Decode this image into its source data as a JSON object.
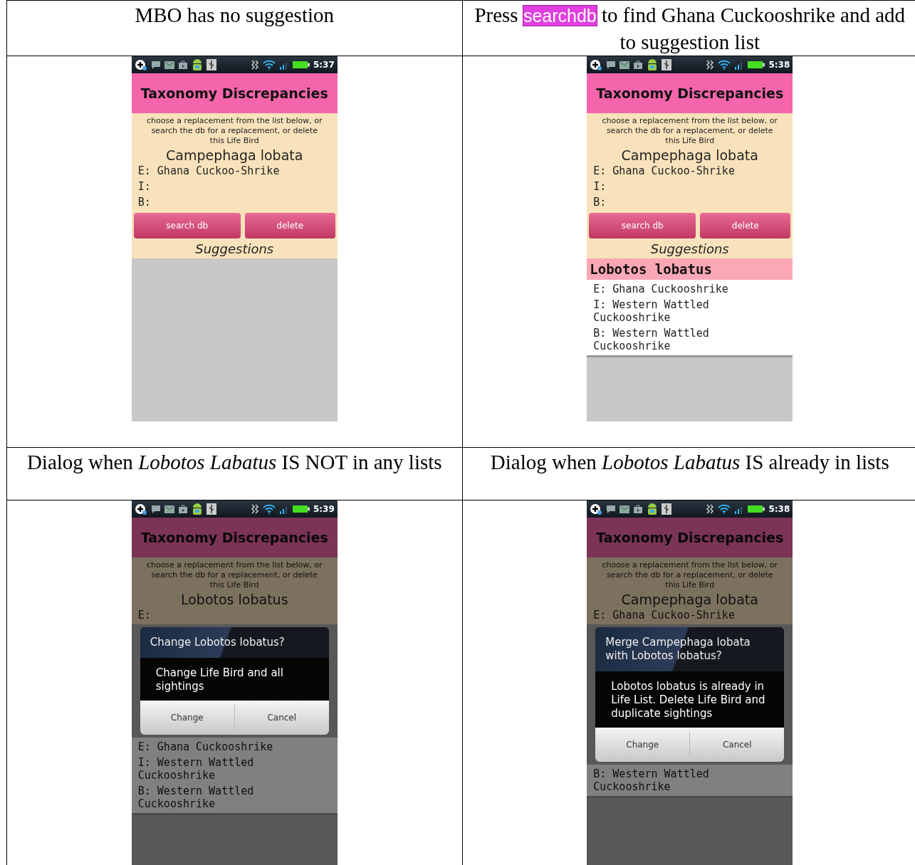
{
  "table": {
    "rows": [
      {
        "cells": [
          {
            "caption": [
              {
                "text": "MBO has no suggestion",
                "highlighted": false
              }
            ],
            "screen": {
              "dimmed": false,
              "time": "5:37",
              "title": "Taxonomy Discrepancies",
              "instructions": "choose a replacement from the list below, or search the db for a replacement, or delete this Life Bird",
              "species": "Campephaga lobata",
              "fields": [
                "E: Ghana Cuckoo-Shrike",
                "I:",
                "B:"
              ],
              "buttons": [
                "search db",
                "delete"
              ],
              "suggestions_heading": "Suggestions"
            }
          },
          {
            "caption": [
              {
                "text": "Press ",
                "highlighted": false
              },
              {
                "text": "searchdb",
                "highlighted": true
              },
              {
                "text": " to find Ghana Cuckooshrike and add to suggestion list",
                "highlighted": false
              }
            ],
            "screen": {
              "dimmed": false,
              "time": "5:38",
              "title": "Taxonomy Discrepancies",
              "instructions": "choose a replacement from the list below, or search the db for a replacement, or delete this Life Bird",
              "species": "Campephaga lobata",
              "fields": [
                "E: Ghana Cuckoo-Shrike",
                "I:",
                "B:"
              ],
              "buttons": [
                "search db",
                "delete"
              ],
              "suggestions_heading": "Suggestions",
              "suggestions": [
                {
                  "name": "Lobotos lobatus",
                  "lines": [
                    "E: Ghana Cuckooshrike",
                    "I: Western Wattled Cuckooshrike",
                    "B: Western Wattled Cuckooshrike"
                  ]
                }
              ]
            }
          }
        ]
      },
      {
        "cells": [
          {
            "caption": [
              {
                "text": "Dialog when *Lobotos Labatus* IS NOT in any lists",
                "highlighted": false
              }
            ],
            "screen": {
              "dimmed": true,
              "time": "5:39",
              "title": "Taxonomy Discrepancies",
              "instructions": "choose a replacement from the list below, or search the db for a replacement, or delete this Life Bird",
              "species": "Lobotos lobatus",
              "fields": [
                "E:"
              ],
              "dialog": {
                "title": "Change Lobotos lobatus?",
                "message": "Change Life Bird and all sightings",
                "buttons": [
                  "Change",
                  "Cancel"
                ]
              },
              "suggestions": [
                {
                  "lines": [
                    "E: Ghana Cuckooshrike",
                    "I: Western Wattled Cuckooshrike",
                    "B: Western Wattled Cuckooshrike"
                  ]
                }
              ]
            }
          },
          {
            "caption": [
              {
                "text": "Dialog when *Lobotos Labatus* IS already in lists",
                "highlighted": false
              }
            ],
            "screen": {
              "dimmed": true,
              "time": "5:38",
              "title": "Taxonomy Discrepancies",
              "instructions": "choose a replacement from the list below, or search the db for a replacement, or delete this Life Bird",
              "species": "Campephaga lobata",
              "fields": [
                "E: Ghana Cuckoo-Shrike"
              ],
              "dialog": {
                "title": "Merge Campephaga lobata with Lobotos lobatus?",
                "message": "Lobotos lobatus is already in Life List. Delete Life Bird and duplicate sightings",
                "buttons": [
                  "Change",
                  "Cancel"
                ]
              },
              "suggestions": [
                {
                  "lines": [
                    "B: Western Wattled Cuckooshrike"
                  ]
                }
              ]
            }
          }
        ]
      }
    ]
  }
}
